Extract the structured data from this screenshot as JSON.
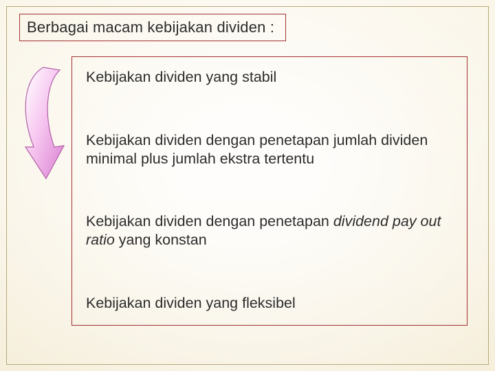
{
  "title": "Berbagai macam kebijakan dividen :",
  "items": [
    {
      "text": "Kebijakan dividen yang stabil"
    },
    {
      "text": "Kebijakan dividen dengan penetapan jumlah dividen minimal plus jumlah ekstra tertentu"
    },
    {
      "prefix": "Kebijakan dividen dengan penetapan ",
      "italic": "dividend pay out ratio",
      "suffix": " yang konstan"
    },
    {
      "text": "Kebijakan dividen yang fleksibel"
    }
  ]
}
